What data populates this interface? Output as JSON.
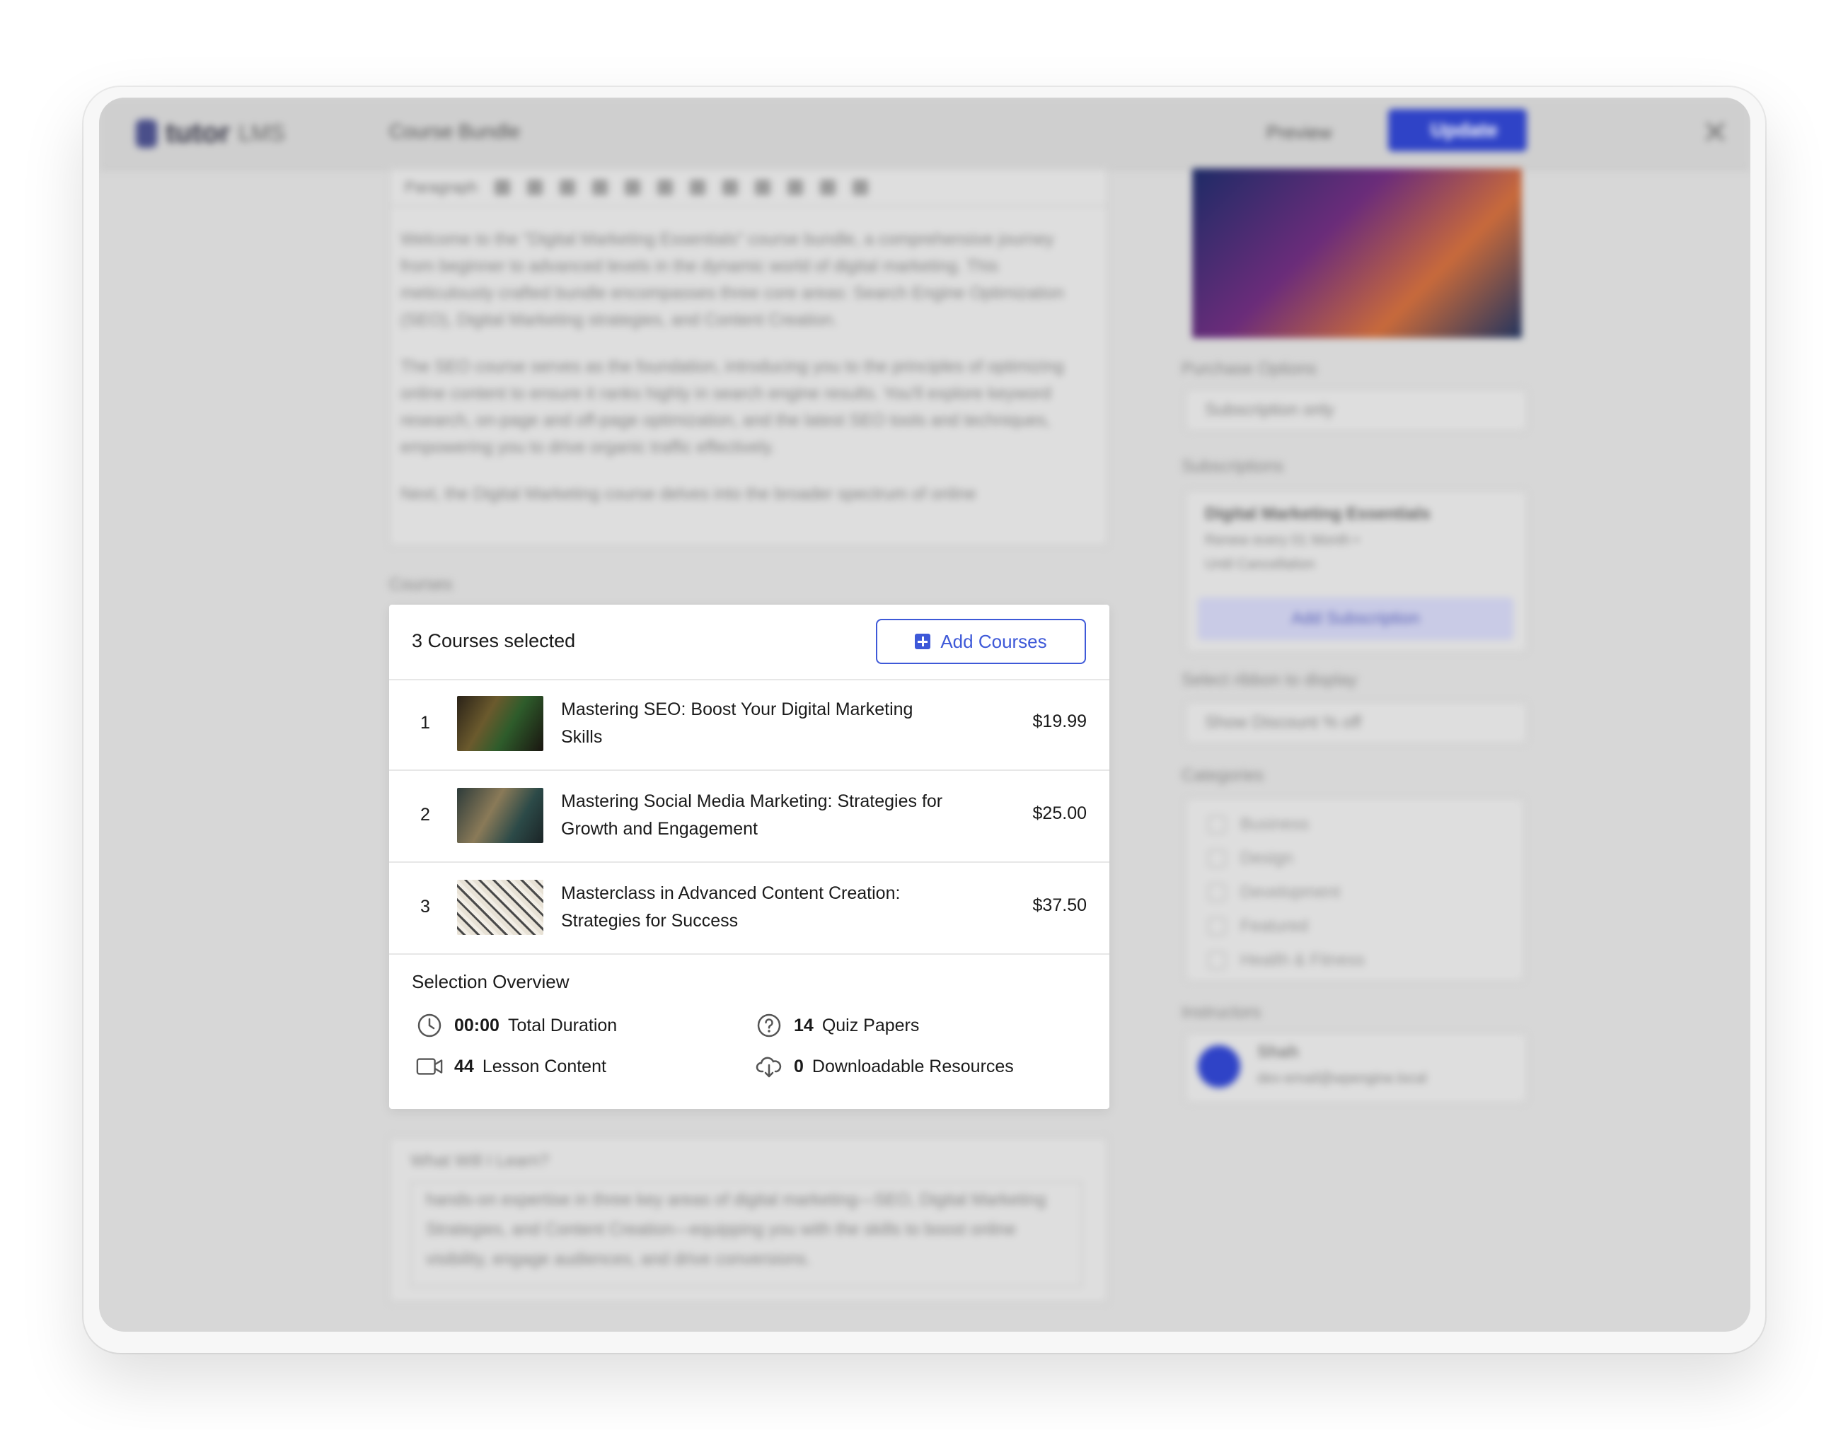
{
  "background": {
    "app": {
      "logo_text": "tutor",
      "logo_suffix": "LMS"
    },
    "header": {
      "title": "Course Bundle",
      "preview_label": "Preview",
      "update_label": "Update"
    },
    "editor": {
      "block_format": "Paragraph",
      "paragraphs": [
        "Welcome to the \"Digital Marketing Essentials\" course bundle, a comprehensive journey from beginner to advanced levels in the dynamic world of digital marketing. This meticulously crafted bundle encompasses three core areas: Search Engine Optimization (SEO), Digital Marketing strategies, and Content Creation.",
        "The SEO course serves as the foundation, introducing you to the principles of optimizing online content to ensure it ranks highly in search engine results. You'll explore keyword research, on-page and off-page optimization, and the latest SEO tools and techniques, empowering you to drive organic traffic effectively.",
        "Next, the Digital Marketing course delves into the broader spectrum of online"
      ]
    },
    "courses_label": "Courses",
    "right": {
      "purchase_options_label": "Purchase Options",
      "purchase_options_value": "Subscription only",
      "subscriptions_label": "Subscriptions",
      "subscription_name": "Digital Marketing Essentials",
      "subscription_detail_1": "Renew every 01 Month •",
      "subscription_detail_2": "Until Cancellation",
      "add_subscription": "Add Subscription",
      "ribbon_label": "Select ribbon to display",
      "ribbon_value": "Show Discount % off",
      "categories_label": "Categories",
      "categories": [
        "Business",
        "Design",
        "Development",
        "Featured",
        "Health & Fitness"
      ],
      "instructors_label": "Instructors",
      "instructor_name": "Shah",
      "instructor_email": "dev-email@wpengine.local"
    },
    "learn": {
      "label": "What Will I Learn?",
      "text": "hands-on expertise in three key areas of digital marketing—SEO, Digital Marketing Strategies, and Content Creation—equipping you with the skills to boost online visibility, engage audiences, and drive conversions."
    }
  },
  "panel": {
    "selected_count": "3 Courses selected",
    "add_courses": "Add Courses",
    "courses": [
      {
        "num": "1",
        "name": "Mastering SEO: Boost Your Digital Marketing Skills",
        "price": "$19.99"
      },
      {
        "num": "2",
        "name": "Mastering Social Media Marketing: Strategies for Growth and Engagement",
        "price": "$25.00"
      },
      {
        "num": "3",
        "name": "Masterclass in Advanced Content Creation: Strategies for Success",
        "price": "$37.50"
      }
    ],
    "overview_title": "Selection Overview",
    "stats": {
      "duration_value": "00:00",
      "duration_label": "Total Duration",
      "quiz_value": "14",
      "quiz_label": "Quiz Papers",
      "lesson_value": "44",
      "lesson_label": "Lesson Content",
      "resources_value": "0",
      "resources_label": "Downloadable Resources"
    }
  },
  "colors": {
    "accent": "#3e59d8",
    "update_button": "#2f43c7"
  }
}
